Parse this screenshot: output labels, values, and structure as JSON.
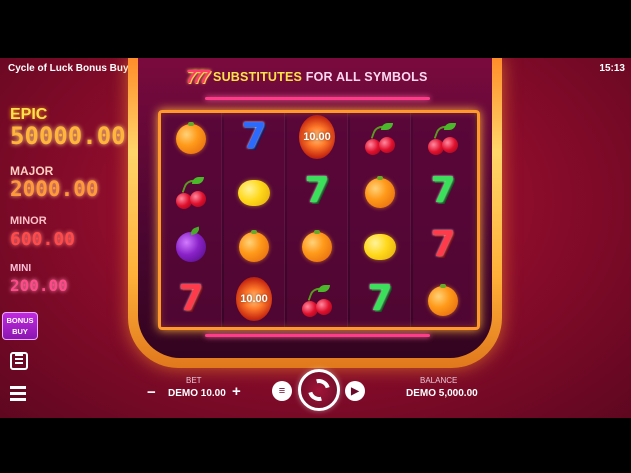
{
  "header": {
    "title": "Cycle of Luck Bonus Buy",
    "clock": "15:13"
  },
  "banner": {
    "sevens": "777",
    "highlight": "SUBSTITUTES",
    "rest": "FOR ALL SYMBOLS"
  },
  "jackpots": {
    "epic": {
      "label": "EPIC",
      "value": "50000.00"
    },
    "major": {
      "label": "MAJOR",
      "value": "2000.00"
    },
    "minor": {
      "label": "MINOR",
      "value": "600.00"
    },
    "mini": {
      "label": "MINI",
      "value": "200.00"
    }
  },
  "bonus_buy": {
    "line1": "BONUS",
    "line2": "BUY"
  },
  "reels": [
    [
      "orange",
      "cherry",
      "plum",
      "seven-red"
    ],
    [
      "seven-blue",
      "lemon",
      "orange",
      "coin"
    ],
    [
      "coin",
      "seven-green",
      "orange",
      "cherry"
    ],
    [
      "cherry",
      "orange",
      "lemon",
      "seven-green"
    ],
    [
      "cherry",
      "seven-green",
      "seven-red",
      "orange"
    ]
  ],
  "coins": {
    "reel3_row1": "10.00",
    "reel2_row4": "10.00"
  },
  "controls": {
    "bet_label": "BET",
    "bet_value": "DEMO 10.00",
    "minus": "−",
    "plus": "+",
    "balance_label": "BALANCE",
    "balance_value": "DEMO 5,000.00"
  },
  "icons": {
    "autoplay": "autoplay-icon",
    "spin": "spin-icon",
    "turbo": "turbo-icon",
    "paytable": "paytable-icon",
    "menu": "menu-icon"
  }
}
